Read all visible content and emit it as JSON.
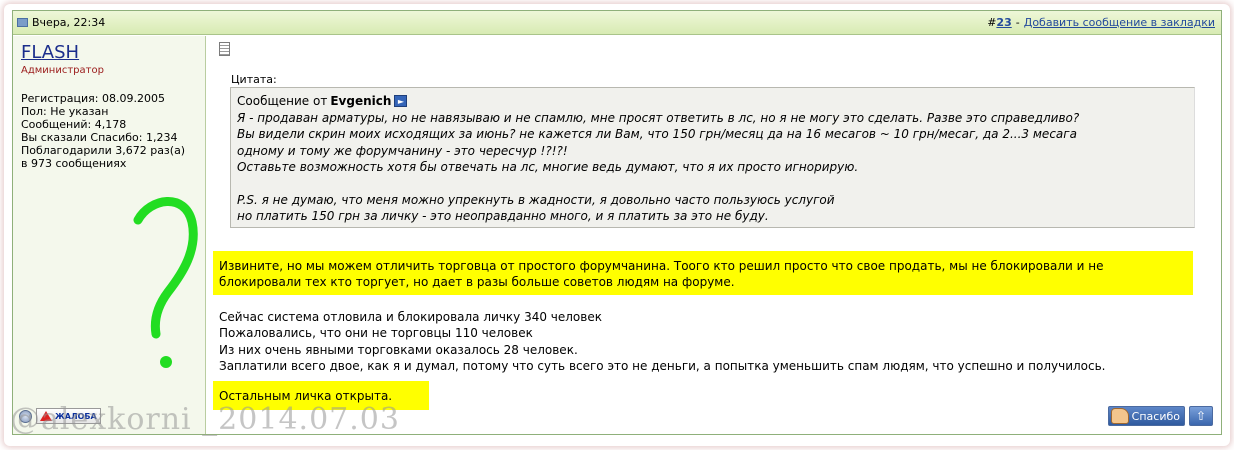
{
  "header": {
    "date": "Вчера, 22:34",
    "post_hash": "#",
    "post_number": "23",
    "bookmark_link": "Добавить сообщение в закладки"
  },
  "user": {
    "name": "FLASH",
    "title": "Администратор",
    "stats": [
      "Регистрация: 08.09.2005",
      "Пол: Не указан",
      "Сообщений: 4,178",
      "Вы сказали Спасибо: 1,234",
      "Поблагодарили 3,672 раз(а)",
      "в 973 сообщениях"
    ],
    "report_label": "ЖАЛОБА"
  },
  "quote": {
    "label": "Цитата:",
    "from_prefix": "Сообщение от",
    "author": "Evgenich",
    "lines": [
      "Я - продаван арматуры, но не навязываю и не спамлю, мне просят ответить в лс, но я не могу это сделать. Разве это справедливо?",
      "Вы видели скрин моих исходящих за июнь? не кажется ли Вам, что 150 грн/месяц да на 16 месагов ~ 10 грн/месаг, да 2...3 месага",
      "одному и тому же форумчанину - это чересчур !?!?!",
      "Оставьте возможность хотя бы отвечать на лс, многие ведь думают, что я их просто игнорирую."
    ],
    "ps_lines": [
      "P.S. я не думаю, что меня можно упрекнуть в жадности, я довольно часто пользуюсь услугой",
      "но платить 150 грн за личку - это неоправданно много, и я платить за это не буду."
    ]
  },
  "reply": {
    "highlight_para_line1": "Извините, но мы можем отличить торговца от простого форумчанина. Тоого кто решил просто что свое продать, мы не блокировали и не",
    "highlight_para_line2": "блокировали тех кто торгует, но дает в разы больше советов людям на форуме.",
    "lines": [
      "Сейчас система отловила и блокировала личку 340 человек",
      "Пожаловались, что они не торговцы 110 человек",
      "Из них очень явными торговками оказалось 28 человек.",
      "Заплатили всего двое, как я и думал, потому что суть всего это не деньги, а попытка уменьшить спам людям, что успешно и получилось."
    ],
    "final": "Остальным личка открыта."
  },
  "buttons": {
    "thanks": "Спасибо",
    "top": "⇧"
  },
  "watermark": "@alexkorni _2014.07.03",
  "colors": {
    "highlight": "#ffff00",
    "annotation_green": "#22dd22",
    "header_link": "#234a9c",
    "username": "#1b2e8c"
  }
}
